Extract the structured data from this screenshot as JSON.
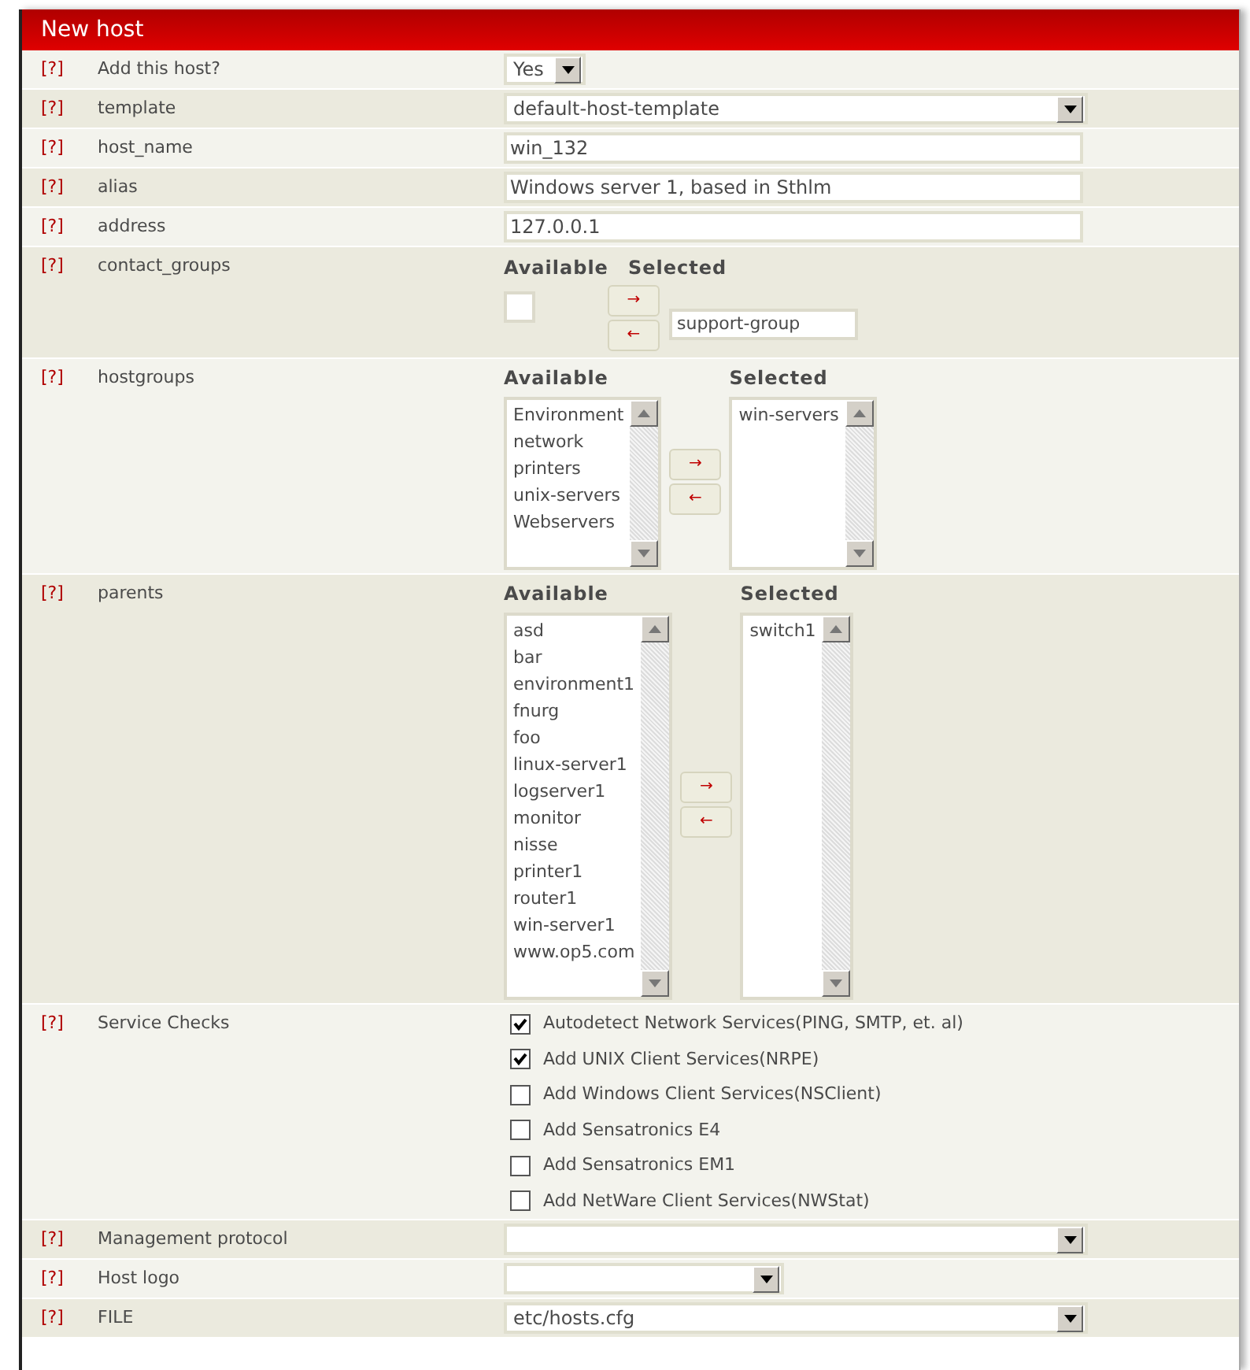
{
  "panel": {
    "title": "New host"
  },
  "fields": [
    {
      "help": "[?]",
      "label": "Add this host?",
      "kind": "short_select",
      "value": "Yes"
    },
    {
      "help": "[?]",
      "label": "template",
      "kind": "select",
      "value": "default-host-template"
    },
    {
      "help": "[?]",
      "label": "host_name",
      "kind": "text",
      "value": "win_132"
    },
    {
      "help": "[?]",
      "label": "alias",
      "kind": "text",
      "value": "Windows server 1, based in Sthlm"
    },
    {
      "help": "[?]",
      "label": "address",
      "kind": "text",
      "value": "127.0.0.1"
    },
    {
      "help": "[?]",
      "label": "contact_groups",
      "kind": "compact_dual",
      "available_label": "Available",
      "selected_label": "Selected",
      "selected": [
        "support-group"
      ],
      "add": "→",
      "remove": "←"
    },
    {
      "help": "[?]",
      "label": "hostgroups",
      "kind": "dual_list",
      "available_label": "Available",
      "selected_label": "Selected",
      "available": [
        "Environment",
        "network",
        "printers",
        "unix-servers",
        "Webservers"
      ],
      "selected": [
        "win-servers"
      ],
      "add": "→",
      "remove": "←"
    },
    {
      "help": "[?]",
      "label": "parents",
      "kind": "dual_list",
      "available_label": "Available",
      "selected_label": "Selected",
      "available": [
        "asd",
        "bar",
        "environment1",
        "fnurg",
        "foo",
        "linux-server1",
        "logserver1",
        "monitor",
        "nisse",
        "printer1",
        "router1",
        "win-server1",
        "www.op5.com"
      ],
      "selected": [
        "switch1"
      ],
      "add": "→",
      "remove": "←"
    },
    {
      "help": "[?]",
      "label": "Service Checks",
      "kind": "checkboxes",
      "options": [
        {
          "label": "Autodetect Network Services(PING, SMTP, et. al)",
          "checked": true
        },
        {
          "label": "Add UNIX Client Services(NRPE)",
          "checked": true
        },
        {
          "label": "Add Windows Client Services(NSClient)",
          "checked": false
        },
        {
          "label": "Add Sensatronics E4",
          "checked": false
        },
        {
          "label": "Add Sensatronics EM1",
          "checked": false
        },
        {
          "label": "Add NetWare Client Services(NWStat)",
          "checked": false
        }
      ]
    },
    {
      "help": "[?]",
      "label": "Management protocol",
      "kind": "select"
    },
    {
      "help": "[?]",
      "label": "Host logo",
      "kind": "medium_select"
    },
    {
      "help": "[?]",
      "label": "FILE",
      "kind": "select",
      "value": "etc/hosts.cfg"
    }
  ]
}
